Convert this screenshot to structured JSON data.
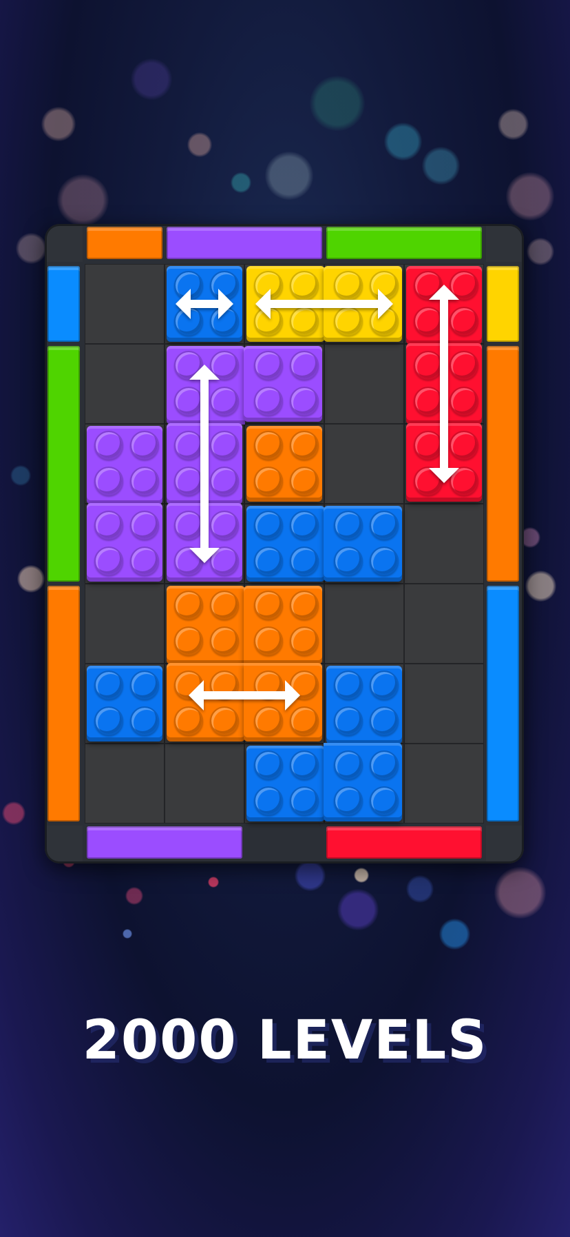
{
  "caption": "2000 LEVELS",
  "board": {
    "cols": 5,
    "rows": 7,
    "frame_color": "#2b2f36",
    "cell_color": "#3a3b3d",
    "colors": {
      "orange": "#ff7a00",
      "purple": "#9b4dff",
      "green": "#4fd400",
      "blue": "#0a74f0",
      "yellow": "#ffd400",
      "red": "#ff1030",
      "sky": "#0a8cff"
    },
    "gates": [
      {
        "side": "top",
        "start": 0,
        "len": 1,
        "color": "orange"
      },
      {
        "side": "top",
        "start": 1,
        "len": 2,
        "color": "purple"
      },
      {
        "side": "top",
        "start": 3,
        "len": 2,
        "color": "green"
      },
      {
        "side": "bottom",
        "start": 0,
        "len": 2,
        "color": "purple"
      },
      {
        "side": "bottom",
        "start": 3,
        "len": 2,
        "color": "red"
      },
      {
        "side": "left",
        "start": 0,
        "len": 1,
        "color": "sky"
      },
      {
        "side": "left",
        "start": 1,
        "len": 3,
        "color": "green"
      },
      {
        "side": "left",
        "start": 4,
        "len": 3,
        "color": "orange"
      },
      {
        "side": "right",
        "start": 0,
        "len": 1,
        "color": "yellow"
      },
      {
        "side": "right",
        "start": 1,
        "len": 3,
        "color": "orange"
      },
      {
        "side": "right",
        "start": 4,
        "len": 3,
        "color": "sky"
      }
    ],
    "blocks": [
      {
        "name": "blue-block-top",
        "color": "blue",
        "cells": [
          [
            1,
            0
          ]
        ],
        "arrow": "horizontal"
      },
      {
        "name": "yellow-block",
        "color": "yellow",
        "cells": [
          [
            2,
            0
          ],
          [
            3,
            0
          ]
        ],
        "arrow": "horizontal"
      },
      {
        "name": "red-block",
        "color": "red",
        "cells": [
          [
            4,
            0
          ],
          [
            4,
            1
          ],
          [
            4,
            2
          ]
        ],
        "arrow": "vertical"
      },
      {
        "name": "purple-block-large",
        "color": "purple",
        "cells": [
          [
            1,
            1
          ],
          [
            2,
            1
          ],
          [
            1,
            2
          ],
          [
            1,
            3
          ]
        ],
        "arrow": "vertical"
      },
      {
        "name": "purple-block-left",
        "color": "purple",
        "cells": [
          [
            0,
            2
          ],
          [
            0,
            3
          ]
        ],
        "arrow": null
      },
      {
        "name": "orange-block-small",
        "color": "orange",
        "cells": [
          [
            2,
            2
          ]
        ],
        "arrow": null
      },
      {
        "name": "blue-block-middle",
        "color": "blue",
        "cells": [
          [
            2,
            3
          ],
          [
            3,
            3
          ]
        ],
        "arrow": null
      },
      {
        "name": "orange-block-large",
        "color": "orange",
        "cells": [
          [
            1,
            4
          ],
          [
            2,
            4
          ],
          [
            1,
            5
          ],
          [
            2,
            5
          ]
        ],
        "arrow": "horizontal"
      },
      {
        "name": "blue-block-left",
        "color": "blue",
        "cells": [
          [
            0,
            5
          ]
        ],
        "arrow": null
      },
      {
        "name": "blue-block-bottom",
        "color": "blue",
        "cells": [
          [
            3,
            5
          ],
          [
            2,
            6
          ],
          [
            3,
            6
          ]
        ],
        "arrow": null
      }
    ]
  }
}
